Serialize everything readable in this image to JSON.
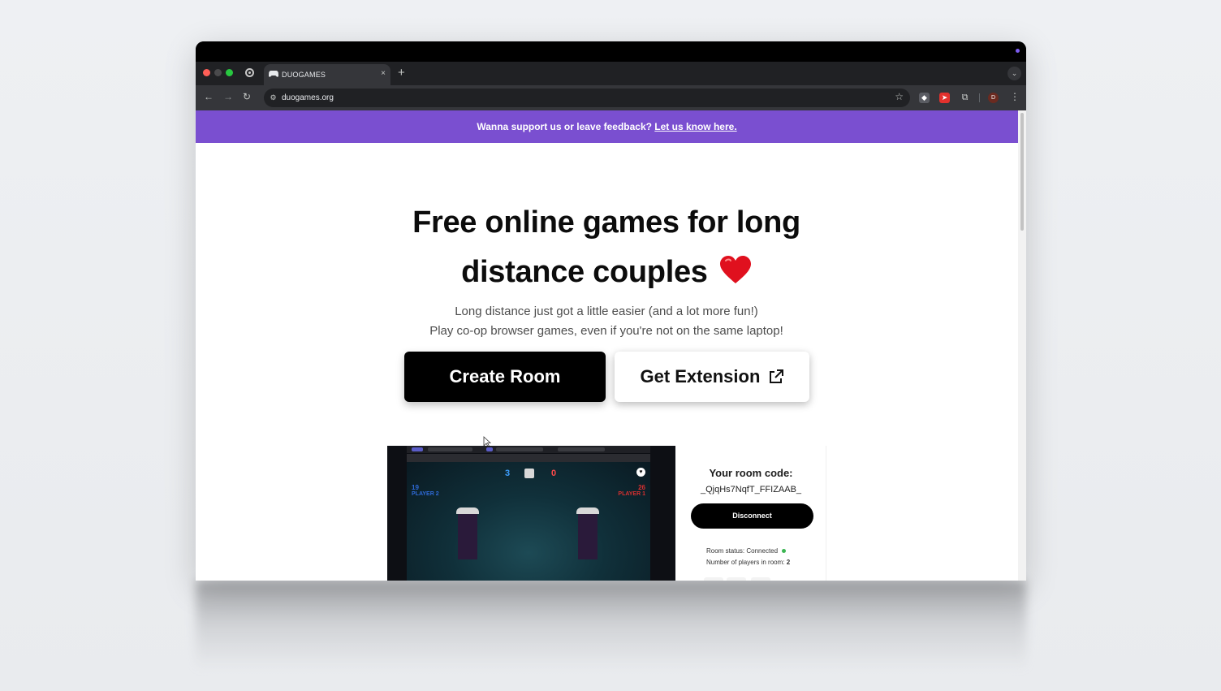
{
  "browser": {
    "tab_title": "DUOGAMES",
    "tab_close": "×",
    "new_tab": "+",
    "tab_search_icon": "chevron-down-icon",
    "url": "duogames.org",
    "profile_initial": "D"
  },
  "banner": {
    "text": "Wanna support us or leave feedback?",
    "link": "Let us know here.",
    "color": "#7a4fd0"
  },
  "hero": {
    "title_line1": "Free online games for long",
    "title_line2": "distance couples",
    "subtitle_line1": "Long distance just got a little easier (and a lot more fun!)",
    "subtitle_line2": "Play co-op browser games, even if you're not on the same laptop!"
  },
  "buttons": {
    "create_room": "Create Room",
    "get_extension": "Get Extension"
  },
  "demo": {
    "score_left": "3",
    "score_right": "0",
    "player2_value": "19",
    "player2_label": "PLAYER 2",
    "player1_value": "26",
    "player1_label": "PLAYER 1",
    "panel": {
      "code_label": "Your room code:",
      "code": "_QjqHs7NqfT_FFIZAAB_",
      "disconnect": "Disconnect",
      "status_label": "Room status:",
      "status_value": "Connected",
      "players_label": "Number of players in room:",
      "players_value": "2"
    }
  }
}
